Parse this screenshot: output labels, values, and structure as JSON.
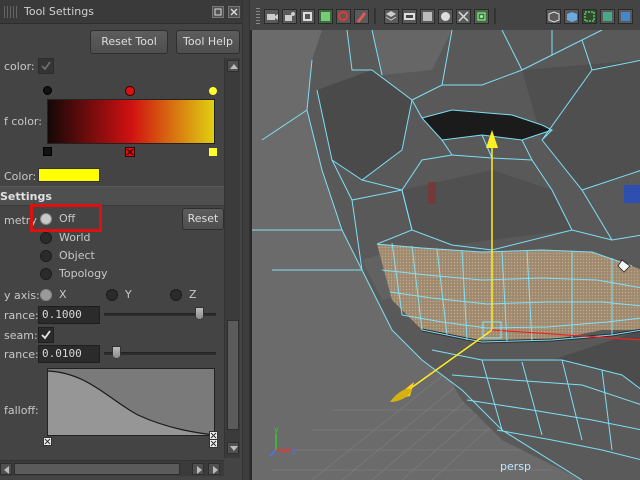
{
  "panel": {
    "title": "Tool Settings",
    "reset_tool": "Reset Tool",
    "tool_help": "Tool Help"
  },
  "settings": {
    "color_label": "color:",
    "ramp_label": "f color:",
    "low_color_label": "Color:",
    "low_color_value": "#ffff00",
    "ramp_colors": [
      "#140808",
      "#d01010",
      "#e0d010"
    ],
    "section_title": "Settings",
    "symmetry_label": "metry",
    "symmetry_options": [
      "Off",
      "World",
      "Object",
      "Topology"
    ],
    "symmetry_selected": "Off",
    "reset_label": "Reset",
    "axis_label": "y axis:",
    "axis_options": [
      "X",
      "Y",
      "Z"
    ],
    "tolerance1_label": "rance:",
    "tolerance1_value": "0.1000",
    "seam_label": "seam:",
    "tolerance2_label": "rance:",
    "tolerance2_value": "0.0100",
    "falloff_label": "falloff:"
  },
  "viewport": {
    "camera_label": "persp"
  },
  "colors": {
    "highlight_box": "#e01010",
    "wire": "#7fe6ff",
    "mesh": "#5e5e5e"
  }
}
